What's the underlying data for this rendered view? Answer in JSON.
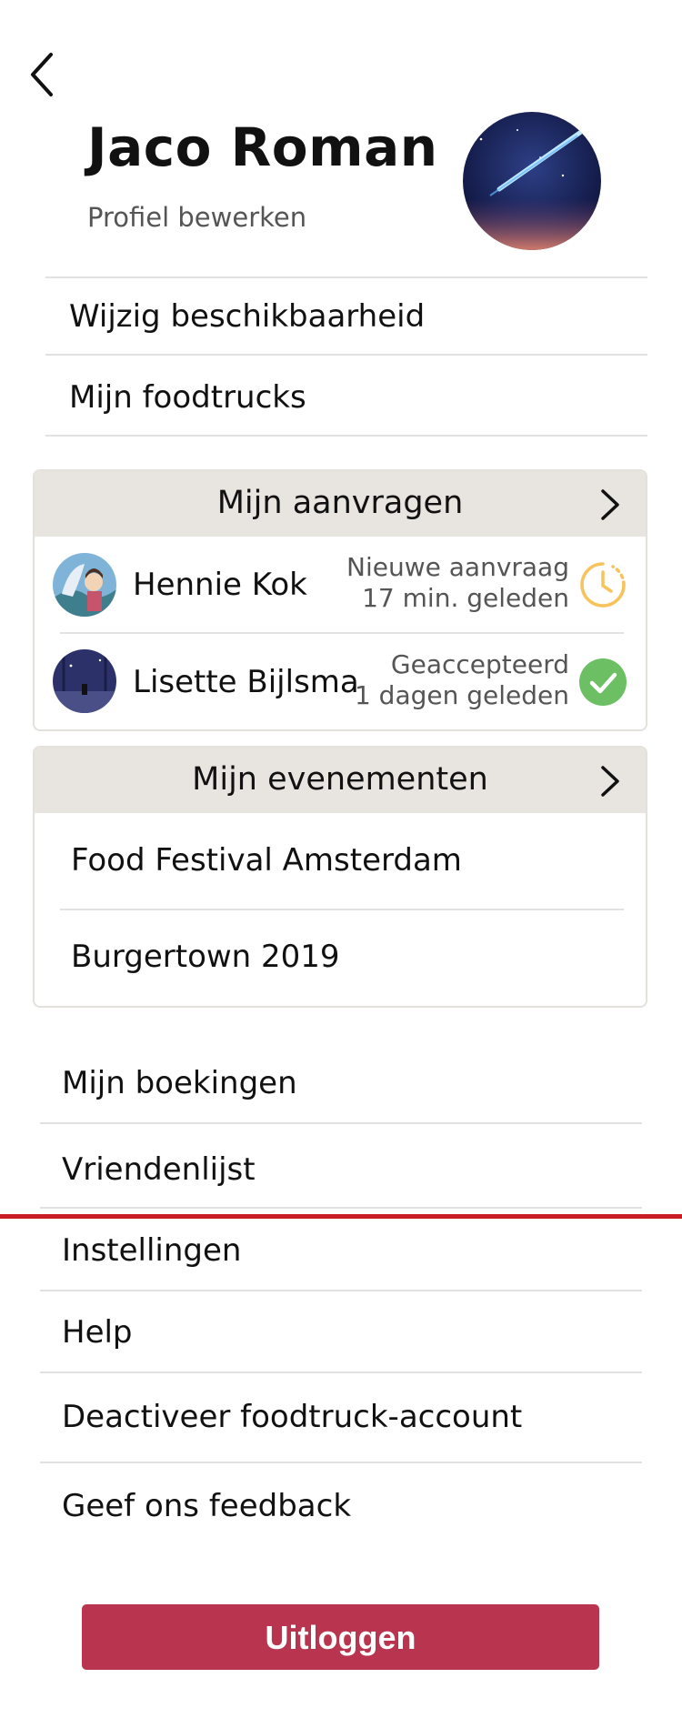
{
  "header": {
    "back_icon": "chevron-left-icon",
    "name": "Jaco Roman",
    "edit_profile": "Profiel bewerken",
    "avatar_icon": "profile-photo-comet"
  },
  "menu_top": [
    {
      "label": "Wijzig beschikbaarheid"
    },
    {
      "label": "Mijn foodtrucks"
    }
  ],
  "requests": {
    "title": "Mijn aanvragen",
    "items": [
      {
        "name": "Hennie Kok",
        "status_line1": "Nieuwe aanvraag",
        "status_line2": "17 min. geleden",
        "status_icon": "clock-pending-icon",
        "status_color": "#f7c35c"
      },
      {
        "name": "Lisette Bijlsma",
        "status_line1": "Geaccepteerd",
        "status_line2": "1 dagen geleden",
        "status_icon": "check-circle-icon",
        "status_color": "#6cbf62"
      }
    ]
  },
  "events": {
    "title": "Mijn evenementen",
    "items": [
      {
        "label": "Food Festival Amsterdam"
      },
      {
        "label": "Burgertown 2019"
      }
    ]
  },
  "menu_bottom": [
    {
      "label": "Mijn boekingen"
    },
    {
      "label": "Vriendenlijst"
    },
    {
      "label": "Instellingen"
    },
    {
      "label": "Help"
    },
    {
      "label": "Deactiveer foodtruck-account"
    },
    {
      "label": "Geef ons feedback"
    }
  ],
  "logout_label": "Uitloggen",
  "colors": {
    "accent": "#b9354f",
    "card_header": "#e8e4e0",
    "divider_red": "#c91c25"
  }
}
